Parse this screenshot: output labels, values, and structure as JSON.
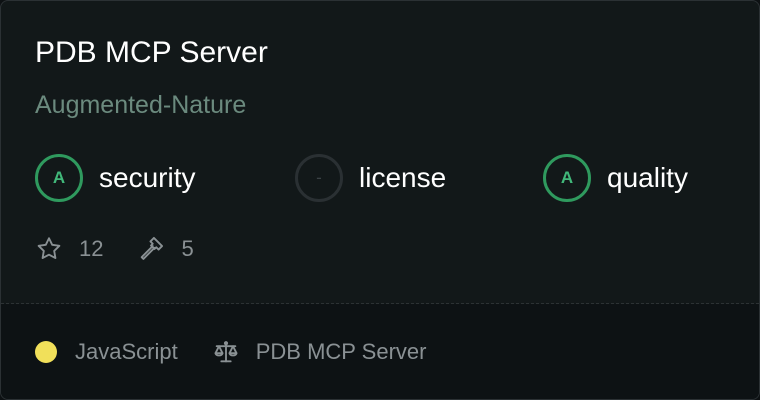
{
  "card": {
    "title": "PDB MCP Server",
    "owner": "Augmented-Nature"
  },
  "scores": [
    {
      "grade": "A",
      "label": "security"
    },
    {
      "grade": "-",
      "label": "license"
    },
    {
      "grade": "A",
      "label": "quality"
    }
  ],
  "stats": {
    "stars": "12",
    "tools": "5",
    "star_icon": "star-icon",
    "tool_icon": "hammer-icon"
  },
  "footer": {
    "language": "JavaScript",
    "language_color": "#f1e05a",
    "license_icon": "scale-icon",
    "license": "PDB MCP Server"
  },
  "colors": {
    "grade_ok": "#2f9a5e",
    "owner": "#6b8a7e"
  }
}
